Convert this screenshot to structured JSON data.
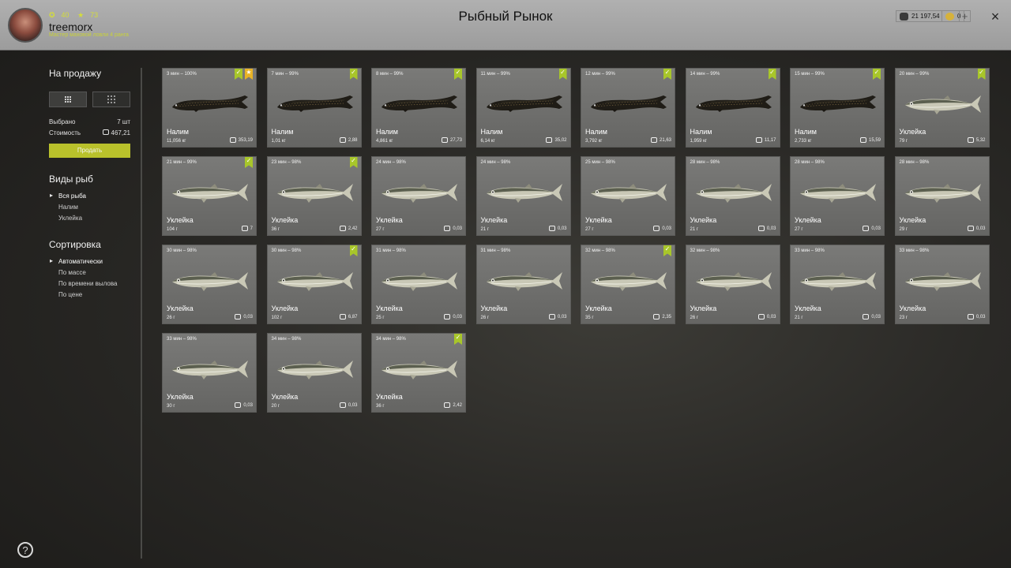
{
  "header": {
    "title": "Рыбный Рынок",
    "level": "40",
    "stars": "73",
    "username": "treemorx",
    "rank": "Мастер маховой ловли 4 ранга",
    "silver": "21 197,54",
    "gold": "0",
    "add_label": "+",
    "close_label": "×"
  },
  "sidebar": {
    "for_sale_title": "На продажу",
    "selected_label": "Выбрано",
    "selected_value": "7 шт",
    "cost_label": "Стоимость",
    "cost_value": "467,21",
    "sell_label": "Продать",
    "species_title": "Виды рыб",
    "species": [
      "Вся рыба",
      "Налим",
      "Уклейка"
    ],
    "sort_title": "Сортировка",
    "sort": [
      "Автоматически",
      "По массе",
      "По времени вылова",
      "По цене"
    ],
    "help_label": "?"
  },
  "cards": [
    {
      "time": "3 мин – 100%",
      "name": "Налим",
      "weight": "11,056 кг",
      "price": "353,19",
      "checked": true,
      "starred": true,
      "fish": "burbot"
    },
    {
      "time": "7 мин – 99%",
      "name": "Налим",
      "weight": "1,01 кг",
      "price": "2,88",
      "checked": true,
      "starred": false,
      "fish": "burbot"
    },
    {
      "time": "8 мин – 99%",
      "name": "Налим",
      "weight": "4,861 кг",
      "price": "27,73",
      "checked": true,
      "starred": false,
      "fish": "burbot"
    },
    {
      "time": "11 мин – 99%",
      "name": "Налим",
      "weight": "6,14 кг",
      "price": "35,02",
      "checked": true,
      "starred": false,
      "fish": "burbot"
    },
    {
      "time": "12 мин – 99%",
      "name": "Налим",
      "weight": "3,792 кг",
      "price": "21,63",
      "checked": true,
      "starred": false,
      "fish": "burbot"
    },
    {
      "time": "14 мин – 99%",
      "name": "Налим",
      "weight": "1,959 кг",
      "price": "11,17",
      "checked": true,
      "starred": false,
      "fish": "burbot"
    },
    {
      "time": "15 мин – 99%",
      "name": "Налим",
      "weight": "2,733 кг",
      "price": "15,59",
      "checked": true,
      "starred": false,
      "fish": "burbot"
    },
    {
      "time": "20 мин – 99%",
      "name": "Уклейка",
      "weight": "79 г",
      "price": "5,32",
      "checked": true,
      "starred": false,
      "fish": "bleak"
    },
    {
      "time": "21 мин – 99%",
      "name": "Уклейка",
      "weight": "104 г",
      "price": "7",
      "checked": true,
      "starred": false,
      "fish": "bleak"
    },
    {
      "time": "23 мин – 98%",
      "name": "Уклейка",
      "weight": "36 г",
      "price": "2,42",
      "checked": true,
      "starred": false,
      "fish": "bleak"
    },
    {
      "time": "24 мин – 98%",
      "name": "Уклейка",
      "weight": "27 г",
      "price": "0,03",
      "checked": false,
      "starred": false,
      "fish": "bleak"
    },
    {
      "time": "24 мин – 98%",
      "name": "Уклейка",
      "weight": "21 г",
      "price": "0,03",
      "checked": false,
      "starred": false,
      "fish": "bleak"
    },
    {
      "time": "25 мин – 98%",
      "name": "Уклейка",
      "weight": "27 г",
      "price": "0,03",
      "checked": false,
      "starred": false,
      "fish": "bleak"
    },
    {
      "time": "28 мин – 98%",
      "name": "Уклейка",
      "weight": "21 г",
      "price": "0,03",
      "checked": false,
      "starred": false,
      "fish": "bleak"
    },
    {
      "time": "28 мин – 98%",
      "name": "Уклейка",
      "weight": "27 г",
      "price": "0,03",
      "checked": false,
      "starred": false,
      "fish": "bleak"
    },
    {
      "time": "28 мин – 98%",
      "name": "Уклейка",
      "weight": "29 г",
      "price": "0,03",
      "checked": false,
      "starred": false,
      "fish": "bleak"
    },
    {
      "time": "30 мин – 98%",
      "name": "Уклейка",
      "weight": "26 г",
      "price": "0,03",
      "checked": false,
      "starred": false,
      "fish": "bleak"
    },
    {
      "time": "30 мин – 98%",
      "name": "Уклейка",
      "weight": "102 г",
      "price": "6,87",
      "checked": true,
      "starred": false,
      "fish": "bleak"
    },
    {
      "time": "31 мин – 98%",
      "name": "Уклейка",
      "weight": "25 г",
      "price": "0,03",
      "checked": false,
      "starred": false,
      "fish": "bleak"
    },
    {
      "time": "31 мин – 98%",
      "name": "Уклейка",
      "weight": "26 г",
      "price": "0,03",
      "checked": false,
      "starred": false,
      "fish": "bleak"
    },
    {
      "time": "32 мин – 98%",
      "name": "Уклейка",
      "weight": "35 г",
      "price": "2,35",
      "checked": true,
      "starred": false,
      "fish": "bleak"
    },
    {
      "time": "32 мин – 98%",
      "name": "Уклейка",
      "weight": "26 г",
      "price": "0,03",
      "checked": false,
      "starred": false,
      "fish": "bleak"
    },
    {
      "time": "33 мин – 98%",
      "name": "Уклейка",
      "weight": "21 г",
      "price": "0,03",
      "checked": false,
      "starred": false,
      "fish": "bleak"
    },
    {
      "time": "33 мин – 98%",
      "name": "Уклейка",
      "weight": "23 г",
      "price": "0,03",
      "checked": false,
      "starred": false,
      "fish": "bleak"
    },
    {
      "time": "33 мин – 98%",
      "name": "Уклейка",
      "weight": "30 г",
      "price": "0,03",
      "checked": false,
      "starred": false,
      "fish": "bleak"
    },
    {
      "time": "34 мин – 98%",
      "name": "Уклейка",
      "weight": "20 г",
      "price": "0,03",
      "checked": false,
      "starred": false,
      "fish": "bleak"
    },
    {
      "time": "34 мин – 98%",
      "name": "Уклейка",
      "weight": "36 г",
      "price": "2,42",
      "checked": true,
      "starred": false,
      "fish": "bleak"
    }
  ]
}
